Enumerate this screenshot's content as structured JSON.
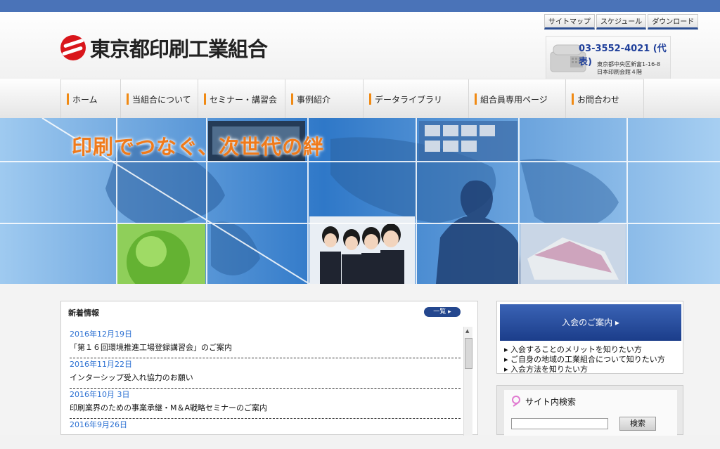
{
  "header": {
    "logo_text": "東京都印刷工業組合",
    "util_links": [
      "サイトマップ",
      "スケジュール",
      "ダウンロード"
    ],
    "phone": "03-3552-4021 (代表)",
    "address_line1": "東京都中央区新富1-16-8",
    "address_line2": "日本印刷会館４階"
  },
  "nav": {
    "items": [
      "ホーム",
      "当組合について",
      "セミナー・講習会",
      "事例紹介",
      "データライブラリ",
      "組合員専用ページ",
      "お問合わせ"
    ]
  },
  "hero": {
    "title": "印刷でつなぐ、次世代の絆"
  },
  "news": {
    "heading": "新着情報",
    "list_button": "一覧",
    "items": [
      {
        "date": "2016年12月19日",
        "title": "「第１６回環境推進工場登録講習会」のご案内"
      },
      {
        "date": "2016年11月22日",
        "title": "インターシップ受入れ協力のお願い"
      },
      {
        "date": "2016年10月 3日",
        "title": "印刷業界のための事業承継・M＆A戦略セミナーのご案内"
      },
      {
        "date": "2016年9月26日",
        "title": ""
      }
    ]
  },
  "join": {
    "heading": "入会のご案内",
    "links": [
      "入会することのメリットを知りたい方",
      "ご自身の地域の工業組合について知りたい方",
      "入会方法を知りたい方"
    ]
  },
  "search": {
    "heading": "サイト内検索",
    "button": "検索",
    "placeholder": ""
  },
  "colors": {
    "brand_blue": "#24478e",
    "accent_orange": "#f08a14",
    "logo_red": "#d9161b",
    "date_blue": "#2a6fd2"
  }
}
